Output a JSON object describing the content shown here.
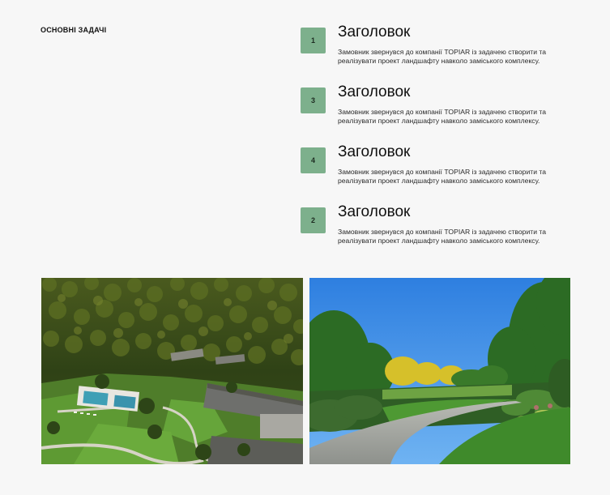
{
  "section": {
    "title": "ОСНОВНІ ЗАДАЧІ"
  },
  "tasks": [
    {
      "number": "1",
      "heading": "Заголовок",
      "text": "Замовник звернувся до компанії TOPIAR із задачею створити та реалізувати проект ландшафту навколо заміського комплексу."
    },
    {
      "number": "3",
      "heading": "Заголовок",
      "text": "Замовник звернувся до компанії TOPIAR із задачею створити та реалізувати проект ландшафту навколо заміського комплексу."
    },
    {
      "number": "4",
      "heading": "Заголовок",
      "text": "Замовник звернувся до компанії TOPIAR із задачею створити та реалізувати проект ландшафту навколо заміського комплексу."
    },
    {
      "number": "2",
      "heading": "Заголовок",
      "text": "Замовник звернувся до компанії TOPIAR із задачею створити та реалізувати проект ландшафту навколо заміського комплексу."
    }
  ],
  "colors": {
    "background": "#f7f7f7",
    "badge": "#7db08c",
    "text": "#1a1a1a"
  }
}
